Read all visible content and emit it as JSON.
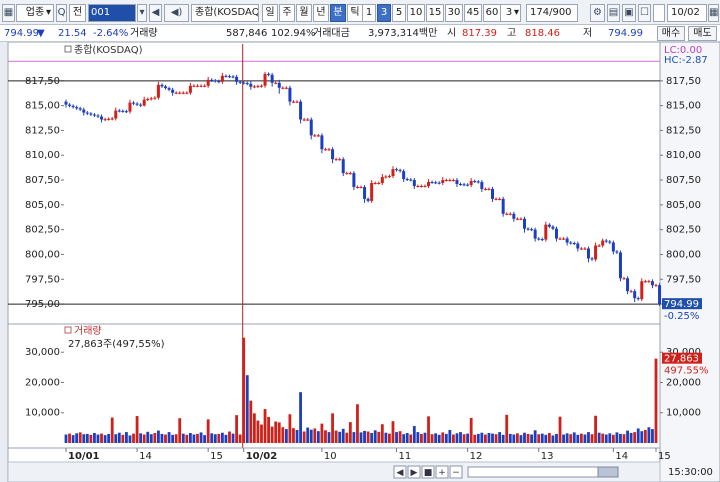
{
  "toolbar": {
    "market_select": "업종",
    "mode": "전",
    "code": "001",
    "name": "종합(KOSDAQ)",
    "periods": [
      "일",
      "주",
      "월",
      "년",
      "분",
      "틱"
    ],
    "selected_period": "분",
    "intervals": [
      "1",
      "3",
      "5",
      "10",
      "15",
      "30",
      "45",
      "60"
    ],
    "selected_interval": "3",
    "interval_value": "3",
    "count": "174/900",
    "date": "10/02",
    "glyphs": [
      "▼",
      "◀",
      "ㅗ",
      "Q",
      "▾",
      "▣",
      "▾"
    ]
  },
  "infobar": {
    "price": "794.99",
    "price_arrow": "▼",
    "change": "21.54",
    "change_pct": "-2.64%",
    "volume_label": "거래량",
    "volume": "587,846",
    "volume_pct": "102.94%",
    "amount_label": "거래대금",
    "amount": "3,973,314백만",
    "open_label": "시",
    "open": "817.39",
    "high_label": "고",
    "high": "818.46",
    "low_label": "저",
    "low": "794.99",
    "buy_button": "매수",
    "sell_button": "매도"
  },
  "colors": {
    "up": "#d0201a",
    "down": "#1c3fbf",
    "hc_line": "#d070d0",
    "price_tag": "#1f4fa8",
    "volume_tag": "#d0201a"
  },
  "chart_data": [
    {
      "type": "candlestick",
      "title": "종합(KOSDAQ)",
      "ylim": [
        794.0,
        820.0
      ],
      "y_ticks": [
        "817,50",
        "815,00",
        "812,50",
        "810,00",
        "807,50",
        "805,00",
        "802,50",
        "800,00",
        "797,50",
        "795,00"
      ],
      "x_labels": [
        "10/01",
        "14",
        "15",
        "10/02",
        "10",
        "11",
        "12",
        "13",
        "14",
        "15"
      ],
      "lc_label": "LC:0.00",
      "hc_label": "HC:-2.87",
      "hc_level": 818.46,
      "last_price_label": "794.99",
      "last_price_pct": "-0.25%",
      "last_price": 794.99,
      "series": [
        {
          "i": 0,
          "o": 815.4,
          "c": 815.1,
          "h": 815.6,
          "l": 814.8
        },
        {
          "i": 5,
          "o": 814.6,
          "c": 814.3,
          "h": 814.8,
          "l": 814.0
        },
        {
          "i": 10,
          "o": 813.9,
          "c": 813.6,
          "h": 814.1,
          "l": 813.3
        },
        {
          "i": 14,
          "o": 813.7,
          "c": 814.5,
          "h": 814.8,
          "l": 813.5
        },
        {
          "i": 18,
          "o": 814.4,
          "c": 815.3,
          "h": 815.6,
          "l": 814.2
        },
        {
          "i": 22,
          "o": 815.0,
          "c": 815.6,
          "h": 815.9,
          "l": 814.9
        },
        {
          "i": 26,
          "o": 815.8,
          "c": 817.1,
          "h": 817.4,
          "l": 815.6
        },
        {
          "i": 30,
          "o": 816.6,
          "c": 816.3,
          "h": 816.8,
          "l": 816.0
        },
        {
          "i": 35,
          "o": 816.3,
          "c": 817.0,
          "h": 817.3,
          "l": 816.1
        },
        {
          "i": 40,
          "o": 817.0,
          "c": 817.6,
          "h": 817.9,
          "l": 816.8
        },
        {
          "i": 44,
          "o": 817.4,
          "c": 818.0,
          "h": 818.3,
          "l": 817.2
        },
        {
          "i": 48,
          "o": 817.9,
          "c": 817.4,
          "h": 818.1,
          "l": 817.1
        },
        {
          "i": 52,
          "o": 817.2,
          "c": 816.9,
          "h": 817.5,
          "l": 816.6
        },
        {
          "i": 56,
          "o": 817.0,
          "c": 818.2,
          "h": 818.4,
          "l": 816.8
        },
        {
          "i": 58,
          "o": 818.1,
          "c": 817.3,
          "h": 818.3,
          "l": 816.9
        },
        {
          "i": 60,
          "o": 817.3,
          "c": 816.8,
          "h": 817.6,
          "l": 816.2
        },
        {
          "i": 63,
          "o": 816.8,
          "c": 815.4,
          "h": 817.0,
          "l": 815.0
        },
        {
          "i": 66,
          "o": 815.4,
          "c": 813.6,
          "h": 815.6,
          "l": 813.2
        },
        {
          "i": 69,
          "o": 813.6,
          "c": 812.0,
          "h": 813.8,
          "l": 811.6
        },
        {
          "i": 72,
          "o": 812.0,
          "c": 810.6,
          "h": 812.2,
          "l": 810.2
        },
        {
          "i": 75,
          "o": 810.6,
          "c": 809.6,
          "h": 810.8,
          "l": 809.2
        },
        {
          "i": 78,
          "o": 809.6,
          "c": 808.2,
          "h": 809.8,
          "l": 807.9
        },
        {
          "i": 81,
          "o": 808.2,
          "c": 806.8,
          "h": 808.4,
          "l": 806.5
        },
        {
          "i": 84,
          "o": 806.8,
          "c": 805.6,
          "h": 807.0,
          "l": 805.2
        },
        {
          "i": 86,
          "o": 805.4,
          "c": 807.2,
          "h": 807.5,
          "l": 805.2
        },
        {
          "i": 89,
          "o": 807.2,
          "c": 807.8,
          "h": 808.1,
          "l": 807.0
        },
        {
          "i": 92,
          "o": 807.9,
          "c": 808.6,
          "h": 808.9,
          "l": 807.7
        },
        {
          "i": 95,
          "o": 808.4,
          "c": 807.6,
          "h": 808.6,
          "l": 807.3
        },
        {
          "i": 98,
          "o": 807.5,
          "c": 806.9,
          "h": 807.7,
          "l": 806.6
        },
        {
          "i": 102,
          "o": 806.9,
          "c": 807.3,
          "h": 807.6,
          "l": 806.7
        },
        {
          "i": 106,
          "o": 807.2,
          "c": 807.5,
          "h": 807.8,
          "l": 807.0
        },
        {
          "i": 110,
          "o": 807.5,
          "c": 807.1,
          "h": 807.7,
          "l": 806.8
        },
        {
          "i": 114,
          "o": 807.0,
          "c": 807.4,
          "h": 807.7,
          "l": 806.8
        },
        {
          "i": 117,
          "o": 807.3,
          "c": 806.6,
          "h": 807.5,
          "l": 806.3
        },
        {
          "i": 120,
          "o": 806.6,
          "c": 805.6,
          "h": 806.8,
          "l": 805.3
        },
        {
          "i": 123,
          "o": 805.6,
          "c": 804.1,
          "h": 805.8,
          "l": 803.8
        },
        {
          "i": 126,
          "o": 804.1,
          "c": 803.6,
          "h": 804.3,
          "l": 803.3
        },
        {
          "i": 129,
          "o": 803.6,
          "c": 802.6,
          "h": 803.8,
          "l": 802.2
        },
        {
          "i": 132,
          "o": 802.5,
          "c": 801.6,
          "h": 802.7,
          "l": 801.3
        },
        {
          "i": 135,
          "o": 801.5,
          "c": 803.0,
          "h": 803.3,
          "l": 801.3
        },
        {
          "i": 138,
          "o": 802.6,
          "c": 801.6,
          "h": 802.8,
          "l": 801.3
        },
        {
          "i": 141,
          "o": 801.6,
          "c": 801.2,
          "h": 801.8,
          "l": 800.9
        },
        {
          "i": 144,
          "o": 801.1,
          "c": 800.6,
          "h": 801.3,
          "l": 800.3
        },
        {
          "i": 147,
          "o": 800.6,
          "c": 799.6,
          "h": 800.8,
          "l": 799.2
        },
        {
          "i": 149,
          "o": 799.5,
          "c": 800.9,
          "h": 801.2,
          "l": 799.3
        },
        {
          "i": 151,
          "o": 800.9,
          "c": 801.4,
          "h": 801.6,
          "l": 800.7
        },
        {
          "i": 154,
          "o": 801.2,
          "c": 800.3,
          "h": 801.4,
          "l": 800.0
        },
        {
          "i": 156,
          "o": 800.2,
          "c": 797.6,
          "h": 800.4,
          "l": 797.3
        },
        {
          "i": 158,
          "o": 797.6,
          "c": 796.3,
          "h": 797.8,
          "l": 796.0
        },
        {
          "i": 160,
          "o": 796.3,
          "c": 795.6,
          "h": 796.5,
          "l": 795.2
        },
        {
          "i": 162,
          "o": 795.5,
          "c": 797.3,
          "h": 797.6,
          "l": 795.3
        },
        {
          "i": 165,
          "o": 797.3,
          "c": 796.9,
          "h": 797.5,
          "l": 796.6
        },
        {
          "i": 167,
          "o": 796.9,
          "c": 794.99,
          "h": 797.1,
          "l": 794.8
        }
      ]
    },
    {
      "type": "bar",
      "title": "거래량",
      "subtitle": "27,863주(497,55%)",
      "ylim": [
        0,
        38000
      ],
      "y_ticks": [
        "30,000",
        "20,000",
        "10,000"
      ],
      "last_volume_label": "27,863",
      "last_volume_pct": "497.55%",
      "values": [
        2800,
        3100,
        2600,
        3200,
        3500,
        2900,
        3000,
        2700,
        3300,
        2800,
        3100,
        2600,
        3000,
        8400,
        2900,
        3400,
        2700,
        3600,
        2500,
        3100,
        8900,
        3200,
        2800,
        3700,
        2900,
        3300,
        4100,
        3000,
        2800,
        3600,
        2700,
        2900,
        8200,
        3100,
        2700,
        3300,
        2800,
        3000,
        3500,
        2600,
        7800,
        3200,
        2900,
        3000,
        3400,
        2700,
        3800,
        3100,
        9200,
        2800,
        34800,
        22400,
        14000,
        9800,
        7400,
        6100,
        11200,
        8600,
        5400,
        7100,
        6800,
        5200,
        4600,
        9500,
        4900,
        4300,
        16800,
        3800,
        5100,
        4400,
        4800,
        3900,
        6400,
        4200,
        3600,
        9800,
        4100,
        3700,
        4700,
        3400,
        6900,
        3600,
        12800,
        3500,
        4000,
        3800,
        3300,
        4200,
        3700,
        6200,
        3400,
        3100,
        7200,
        3600,
        3900,
        2900,
        3300,
        2800,
        5600,
        3600,
        3000,
        3400,
        8800,
        2900,
        3200,
        2700,
        3500,
        3000,
        4300,
        2800,
        3200,
        3600,
        2900,
        3100,
        8300,
        2700,
        3000,
        3400,
        2800,
        3300,
        3100,
        2900,
        3600,
        2700,
        9300,
        3000,
        2800,
        3200,
        2600,
        3400,
        3000,
        2800,
        4200,
        2900,
        3100,
        2700,
        3300,
        2500,
        3000,
        8700,
        2800,
        3200,
        2900,
        3500,
        2700,
        3100,
        2800,
        3600,
        2900,
        9000,
        3400,
        3100,
        2800,
        3200,
        2700,
        3500,
        3000,
        2900,
        4100,
        3300,
        3600,
        4800,
        3900,
        4300,
        5200,
        4600,
        27863
      ]
    }
  ]
}
